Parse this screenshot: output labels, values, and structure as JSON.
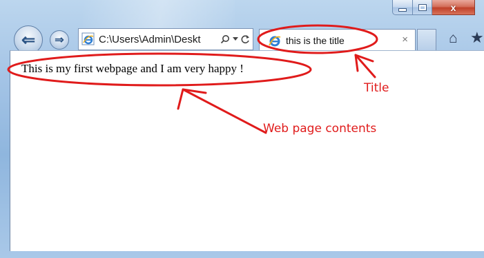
{
  "window": {
    "close_glyph": "x",
    "accent_close": "#c8462f",
    "chrome_blue": "#a4c4e6"
  },
  "nav": {
    "back_glyph": "⇐",
    "forward_glyph": "⇒"
  },
  "address_bar": {
    "value": "C:\\Users\\Admin\\Deskt",
    "icons": [
      "search-icon",
      "dropdown-icon",
      "refresh-icon"
    ]
  },
  "tab": {
    "title": "this is the title",
    "close": "×"
  },
  "toolbar": {
    "icons": [
      "home-icon",
      "favorites-star-icon"
    ]
  },
  "page": {
    "text": "This is my first webpage and I am very happy !"
  },
  "annotations": {
    "color": "#e01b1b",
    "title_label": "Title",
    "contents_label": "Web page contents"
  }
}
